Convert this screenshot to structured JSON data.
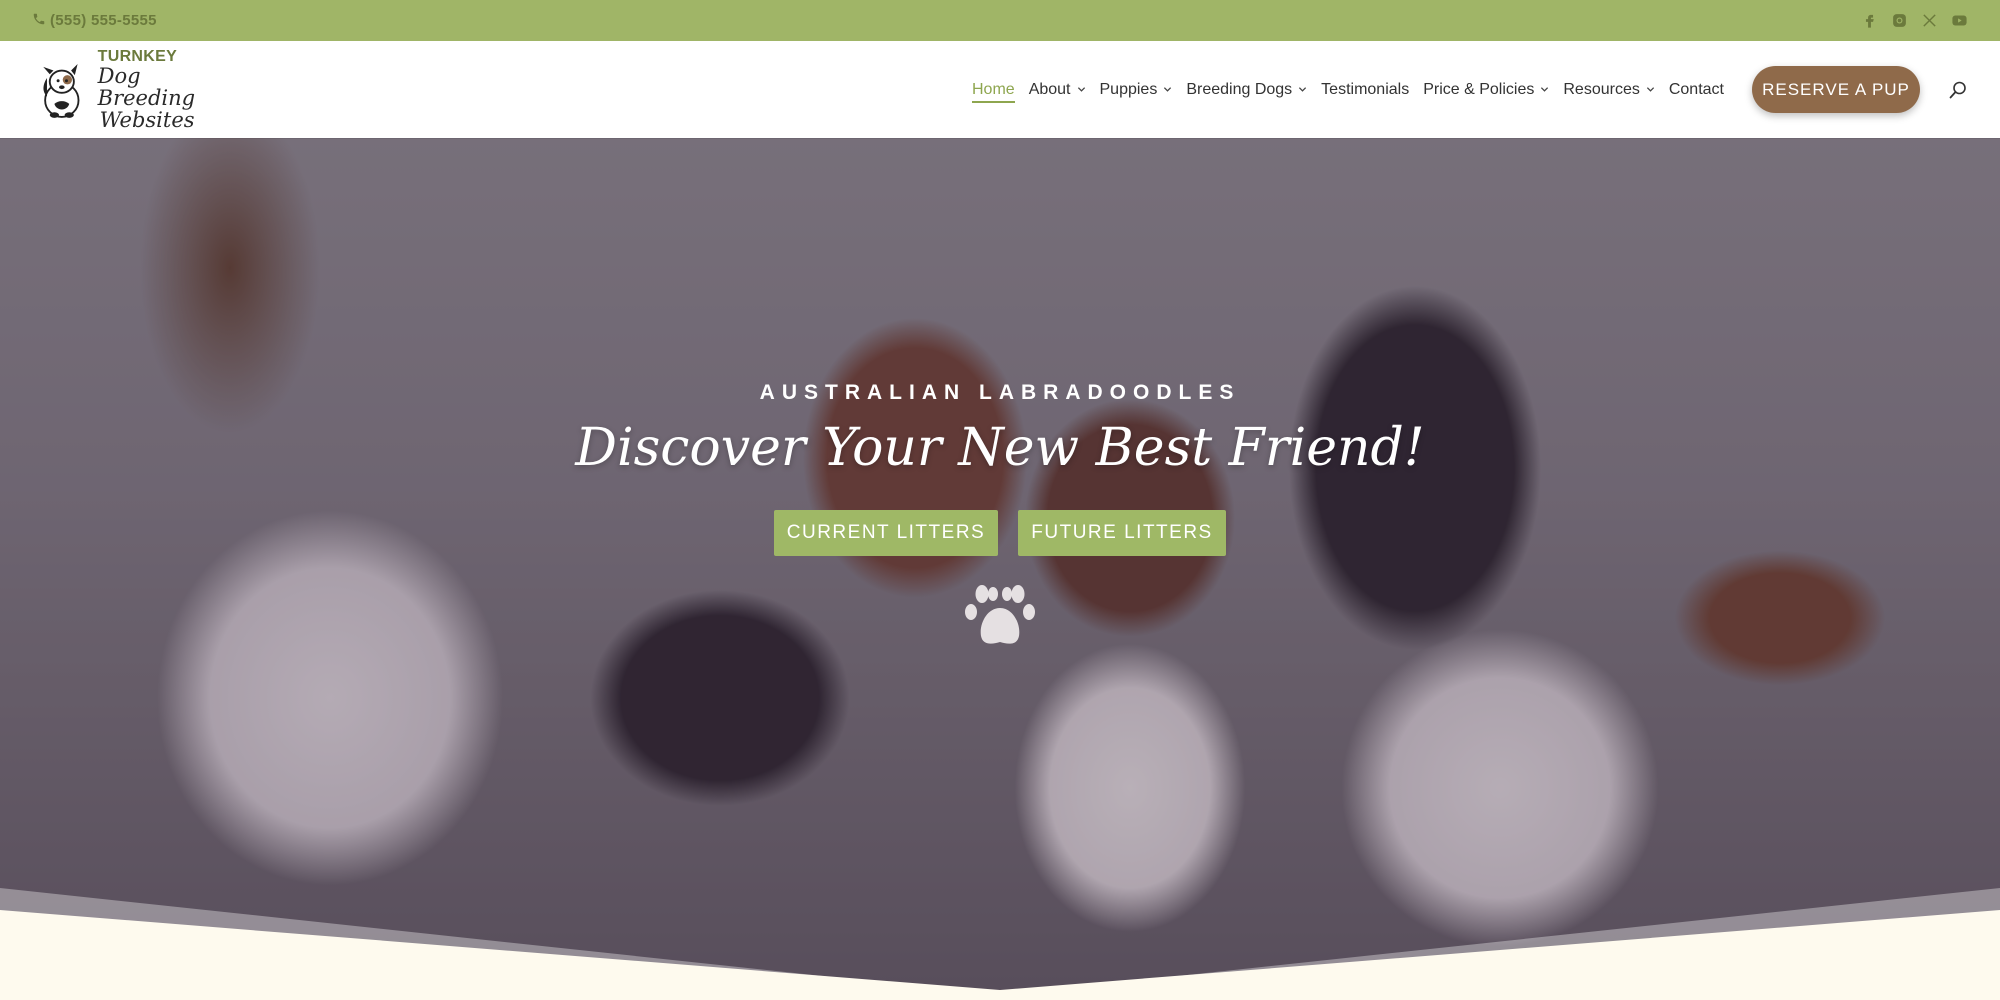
{
  "topbar": {
    "phone": "(555) 555-5555",
    "social_icons": [
      "facebook-icon",
      "instagram-icon",
      "x-icon",
      "youtube-icon"
    ]
  },
  "logo": {
    "line1": "TURNKEY",
    "line2": "Dog Breeding",
    "line3": "Websites"
  },
  "nav": {
    "items": [
      {
        "label": "Home",
        "dropdown": false,
        "active": true
      },
      {
        "label": "About",
        "dropdown": true
      },
      {
        "label": "Puppies",
        "dropdown": true
      },
      {
        "label": "Breeding Dogs",
        "dropdown": true
      },
      {
        "label": "Testimonials",
        "dropdown": false
      },
      {
        "label": "Price & Policies",
        "dropdown": true
      },
      {
        "label": "Resources",
        "dropdown": true
      },
      {
        "label": "Contact",
        "dropdown": false
      }
    ],
    "cta": "RESERVE A PUP"
  },
  "hero": {
    "eyebrow": "AUSTRALIAN LABRADOODLES",
    "headline": "Discover Your New Best Friend!",
    "buttons": [
      "CURRENT LITTERS",
      "FUTURE LITTERS"
    ]
  },
  "colors": {
    "topbar": "#a0b567",
    "accent_green": "#9fb866",
    "cta_brown": "#8f6a4a",
    "page_bg": "#fefaee"
  }
}
